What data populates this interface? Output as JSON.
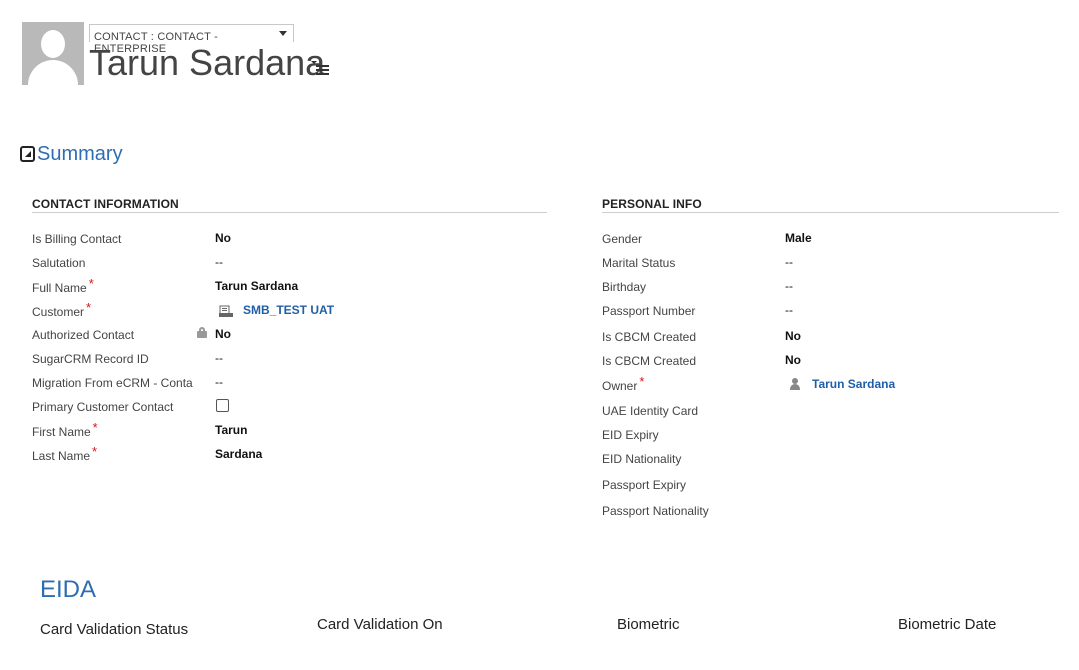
{
  "header": {
    "form_selector": "CONTACT : CONTACT - ENTERPRISE",
    "record_name": "Tarun Sardana"
  },
  "summary": {
    "title": "Summary",
    "contact_information": {
      "heading": "CONTACT INFORMATION",
      "fields": {
        "billing_contact": {
          "label": "Is Billing Contact",
          "value": "No"
        },
        "salutation": {
          "label": "Salutation",
          "value": "--"
        },
        "full_name": {
          "label": "Full Name",
          "value": "Tarun Sardana",
          "required": "*"
        },
        "customer": {
          "label": "Customer",
          "value": "SMB_TEST UAT",
          "required": "*"
        },
        "authorized_contact": {
          "label": "Authorized Contact",
          "value": "No"
        },
        "sugarcrm_id": {
          "label": "SugarCRM Record ID",
          "value": "--"
        },
        "migration": {
          "label": "Migration From eCRM - Conta",
          "value": "--"
        },
        "primary_customer_contact": {
          "label": "Primary Customer Contact",
          "checked": false
        },
        "first_name": {
          "label": "First Name",
          "value": "Tarun",
          "required": "*"
        },
        "last_name": {
          "label": "Last Name",
          "value": "Sardana",
          "required": "*"
        }
      }
    },
    "personal_info": {
      "heading": "PERSONAL INFO",
      "fields": {
        "gender": {
          "label": "Gender",
          "value": "Male"
        },
        "marital_status": {
          "label": "Marital Status",
          "value": "--"
        },
        "birthday": {
          "label": "Birthday",
          "value": "--"
        },
        "passport_number": {
          "label": "Passport Number",
          "value": "--"
        },
        "cbcm_created_1": {
          "label": "Is CBCM Created",
          "value": "No"
        },
        "cbcm_created_2": {
          "label": "Is CBCM Created",
          "value": "No"
        },
        "owner": {
          "label": "Owner",
          "value": "Tarun Sardana",
          "required": "*"
        },
        "uae_identity_card": {
          "label": "UAE Identity Card"
        },
        "eid_expiry": {
          "label": "EID Expiry"
        },
        "eid_nationality": {
          "label": "EID Nationality"
        },
        "passport_expiry": {
          "label": "Passport Expiry"
        },
        "passport_nationality": {
          "label": "Passport Nationality"
        }
      }
    }
  },
  "eida": {
    "title": "EIDA",
    "columns": [
      "Card Validation Status",
      "Card Validation On",
      "Biometric",
      "Biometric Date"
    ]
  },
  "colors": {
    "accent": "#2e6db4",
    "link": "#1f5fa8",
    "required": "#dd1111",
    "avatar_bg": "#b9b9b9"
  },
  "icons": {
    "avatar": "person-silhouette",
    "title_menu": "list-menu-icon",
    "collapse": "collapse-triangle-icon",
    "lock": "lock-icon",
    "account": "account-icon",
    "owner": "person-icon"
  }
}
